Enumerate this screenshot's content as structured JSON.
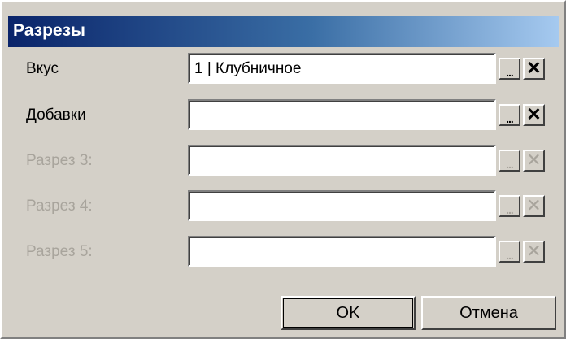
{
  "dialog": {
    "title": "Разрезы"
  },
  "rows": [
    {
      "label": "Вкус",
      "value": "1 | Клубничное",
      "enabled": true,
      "dots_label": "...",
      "clear_label": "✕"
    },
    {
      "label": "Добавки",
      "value": "",
      "enabled": true,
      "dots_label": "...",
      "clear_label": "✕"
    },
    {
      "label": "Разрез 3:",
      "value": "",
      "enabled": false,
      "dots_label": "...",
      "clear_label": "✕"
    },
    {
      "label": "Разрез 4:",
      "value": "",
      "enabled": false,
      "dots_label": "...",
      "clear_label": "✕"
    },
    {
      "label": "Разрез 5:",
      "value": "",
      "enabled": false,
      "dots_label": "...",
      "clear_label": "✕"
    }
  ],
  "buttons": {
    "ok_label": "OK",
    "cancel_label": "Отмена"
  },
  "colors": {
    "face": "#d4d0c8",
    "title_start": "#0a246a",
    "title_end": "#a6caf0",
    "disabled_text": "#a8a49c"
  }
}
